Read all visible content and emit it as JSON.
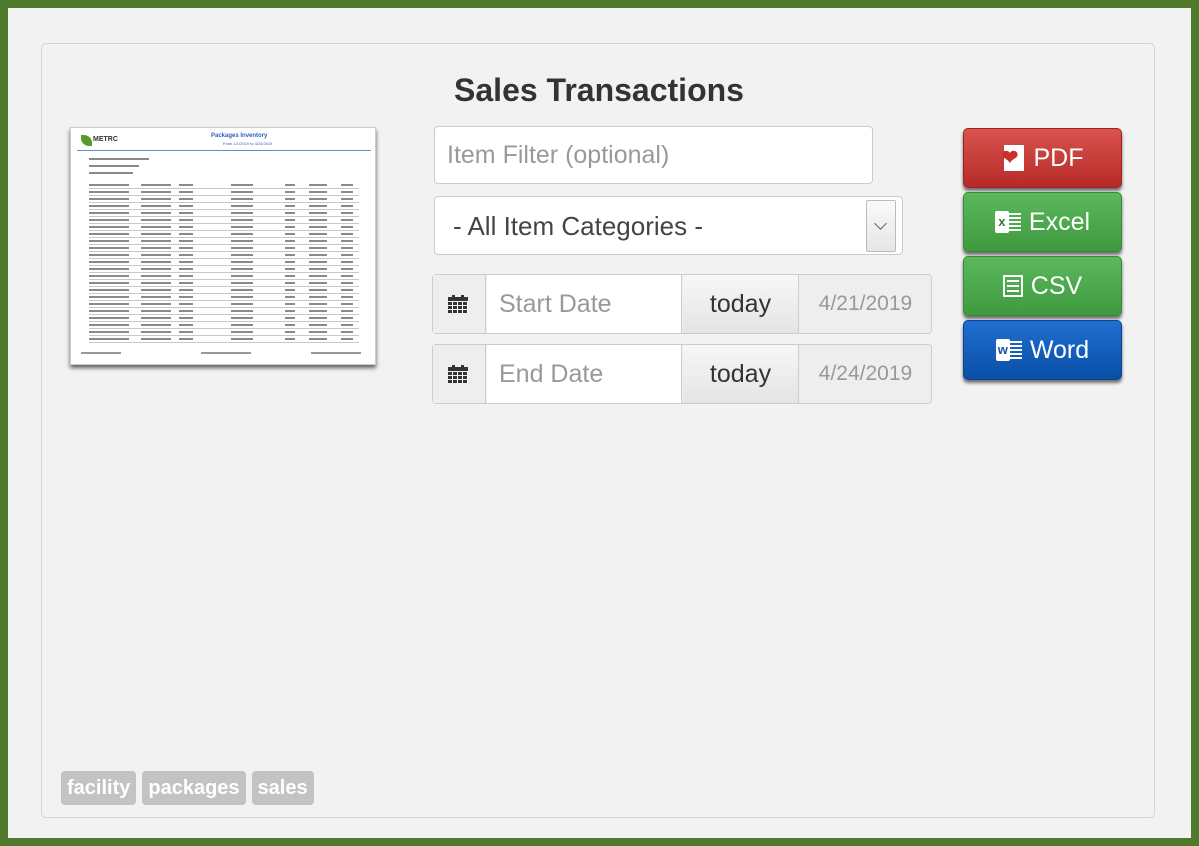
{
  "page": {
    "title": "Sales Transactions"
  },
  "thumbnail": {
    "logo_text": "METRC",
    "report_title": "Packages Inventory",
    "report_subtitle": "From 1/1/2019 to 4/24/2019"
  },
  "filters": {
    "item_filter": {
      "placeholder": "Item Filter (optional)",
      "value": ""
    },
    "category_select": {
      "selected": "- All Item Categories -"
    },
    "start_date": {
      "placeholder": "Start Date",
      "today_label": "today",
      "value": "4/21/2019"
    },
    "end_date": {
      "placeholder": "End Date",
      "today_label": "today",
      "value": "4/24/2019"
    }
  },
  "export_buttons": {
    "pdf": "PDF",
    "excel": "Excel",
    "csv": "CSV",
    "word": "Word"
  },
  "tags": [
    "facility",
    "packages",
    "sales"
  ],
  "colors": {
    "frame_border": "#4f7a2c",
    "pdf": "#c9302c",
    "excel": "#449d44",
    "csv": "#449d44",
    "word": "#0e5bbd",
    "tag": "#c3c3c3"
  },
  "icons": {
    "pdf": "pdf-icon",
    "excel": "excel-icon",
    "csv": "csv-icon",
    "word": "word-icon",
    "calendar": "calendar-icon"
  }
}
